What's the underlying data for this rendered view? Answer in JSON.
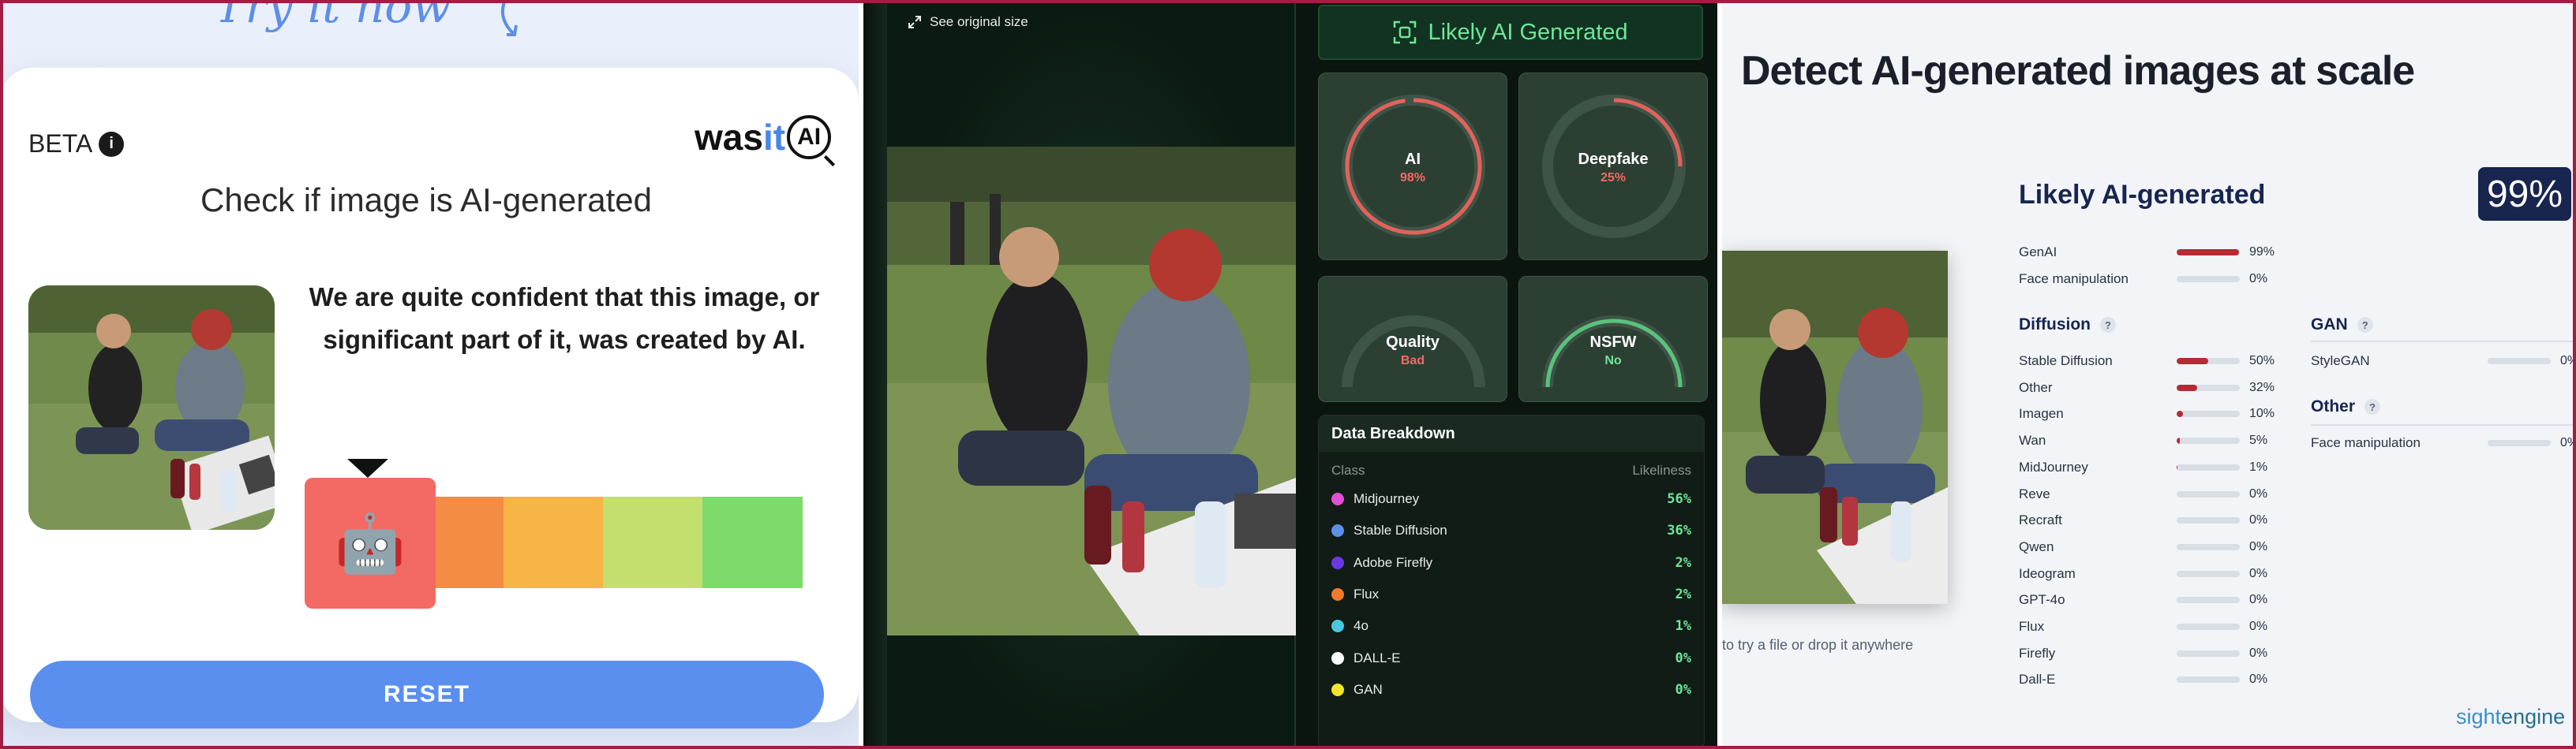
{
  "panel1": {
    "try_text": "Try it now",
    "beta_label": "BETA",
    "info_glyph": "i",
    "logo": {
      "was": "was",
      "it": "it",
      "ai": "AI"
    },
    "title": "Check if image is AI-generated",
    "verdict": "We are quite confident that this image, or significant part of it, was created by AI.",
    "scale_colors": [
      "#f26a63",
      "#f58c45",
      "#f7b447",
      "#c5df6f",
      "#7fda6c"
    ],
    "robot_glyph": "🤖",
    "reset_label": "RESET"
  },
  "panel2": {
    "see_original": "See original size",
    "badge": "Likely AI Generated",
    "gauges": [
      {
        "label": "AI",
        "value": "98%",
        "fraction": 0.98,
        "color": "#e4625c",
        "value_color": "#f06a62"
      },
      {
        "label": "Deepfake",
        "value": "25%",
        "fraction": 0.25,
        "color": "#e4625c",
        "value_color": "#f06a62"
      },
      {
        "label": "Quality",
        "value": "Bad",
        "fraction": 0.0,
        "color": "#e4625c",
        "value_color": "#f06a62"
      },
      {
        "label": "NSFW",
        "value": "No",
        "fraction": 1.0,
        "color": "#5ac27d",
        "value_color": "#6fe59a"
      }
    ],
    "breakdown": {
      "title": "Data Breakdown",
      "col_class": "Class",
      "col_likeliness": "Likeliness",
      "rows": [
        {
          "name": "Midjourney",
          "value": "56%",
          "color": "#e04fd6"
        },
        {
          "name": "Stable Diffusion",
          "value": "36%",
          "color": "#5b8fe8"
        },
        {
          "name": "Adobe Firefly",
          "value": "2%",
          "color": "#6b38e6"
        },
        {
          "name": "Flux",
          "value": "2%",
          "color": "#f07a2a"
        },
        {
          "name": "4o",
          "value": "1%",
          "color": "#48c8e0"
        },
        {
          "name": "DALL-E",
          "value": "0%",
          "color": "#ffffff"
        },
        {
          "name": "GAN",
          "value": "0%",
          "color": "#f2e52c"
        }
      ]
    }
  },
  "panel3": {
    "headline": "Detect AI-generated images at scale",
    "likely": "Likely AI-generated",
    "score": "99%",
    "hint": "to try a file or drop it anywhere",
    "top_metrics": [
      {
        "label": "GenAI",
        "value": "99%",
        "fraction": 0.99
      },
      {
        "label": "Face manipulation",
        "value": "0%",
        "fraction": 0.0
      }
    ],
    "diffusion_title": "Diffusion",
    "diffusion": [
      {
        "label": "Stable Diffusion",
        "value": "50%",
        "fraction": 0.5
      },
      {
        "label": "Other",
        "value": "32%",
        "fraction": 0.32
      },
      {
        "label": "Imagen",
        "value": "10%",
        "fraction": 0.1
      },
      {
        "label": "Wan",
        "value": "5%",
        "fraction": 0.05
      },
      {
        "label": "MidJourney",
        "value": "1%",
        "fraction": 0.01
      },
      {
        "label": "Reve",
        "value": "0%",
        "fraction": 0.0
      },
      {
        "label": "Recraft",
        "value": "0%",
        "fraction": 0.0
      },
      {
        "label": "Qwen",
        "value": "0%",
        "fraction": 0.0
      },
      {
        "label": "Ideogram",
        "value": "0%",
        "fraction": 0.0
      },
      {
        "label": "GPT-4o",
        "value": "0%",
        "fraction": 0.0
      },
      {
        "label": "Flux",
        "value": "0%",
        "fraction": 0.0
      },
      {
        "label": "Firefly",
        "value": "0%",
        "fraction": 0.0
      },
      {
        "label": "Dall-E",
        "value": "0%",
        "fraction": 0.0
      }
    ],
    "gan_title": "GAN",
    "gan": [
      {
        "label": "StyleGAN",
        "value": "0%",
        "fraction": 0.0
      }
    ],
    "other_title": "Other",
    "other": [
      {
        "label": "Face manipulation",
        "value": "0%",
        "fraction": 0.0
      }
    ],
    "brand": {
      "sight": "sight",
      "engine": "engine"
    }
  }
}
